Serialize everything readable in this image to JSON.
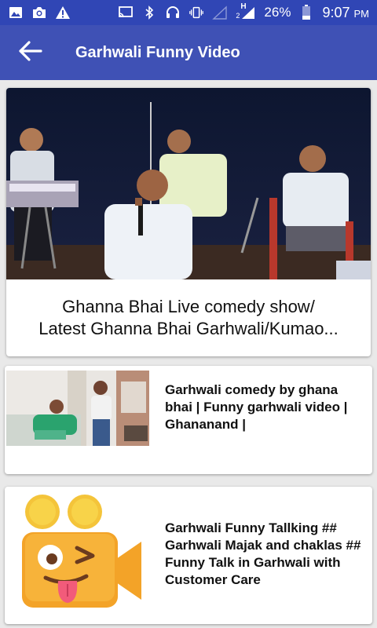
{
  "status_bar": {
    "network_label": "H",
    "sim_label": "2",
    "battery": "26%",
    "time": "9:07",
    "ampm": "PM",
    "icons": [
      "image-icon",
      "camera-icon",
      "warning-icon",
      "cast-icon",
      "bluetooth-icon",
      "headset-icon",
      "vibrate-icon",
      "signal-empty-icon",
      "signal-icon",
      "battery-icon"
    ]
  },
  "app_bar": {
    "title": "Garhwali Funny Video",
    "back_icon": "arrow-left-icon"
  },
  "videos": [
    {
      "line1": "Ghanna Bhai Live comedy show/",
      "line2": "Latest Ghanna Bhai Garhwali/Kumao..."
    },
    {
      "title": "Garhwali comedy by ghana bhai | Funny garhwali video | Ghananand |"
    },
    {
      "title": "Garhwali Funny Tallking ## Garhwali Majak and chaklas ## Funny Talk in Garhwali with Customer Care"
    }
  ],
  "colors": {
    "status_bar": "#3046b5",
    "app_bar": "#3f51b5",
    "background": "#e9e9e9"
  }
}
